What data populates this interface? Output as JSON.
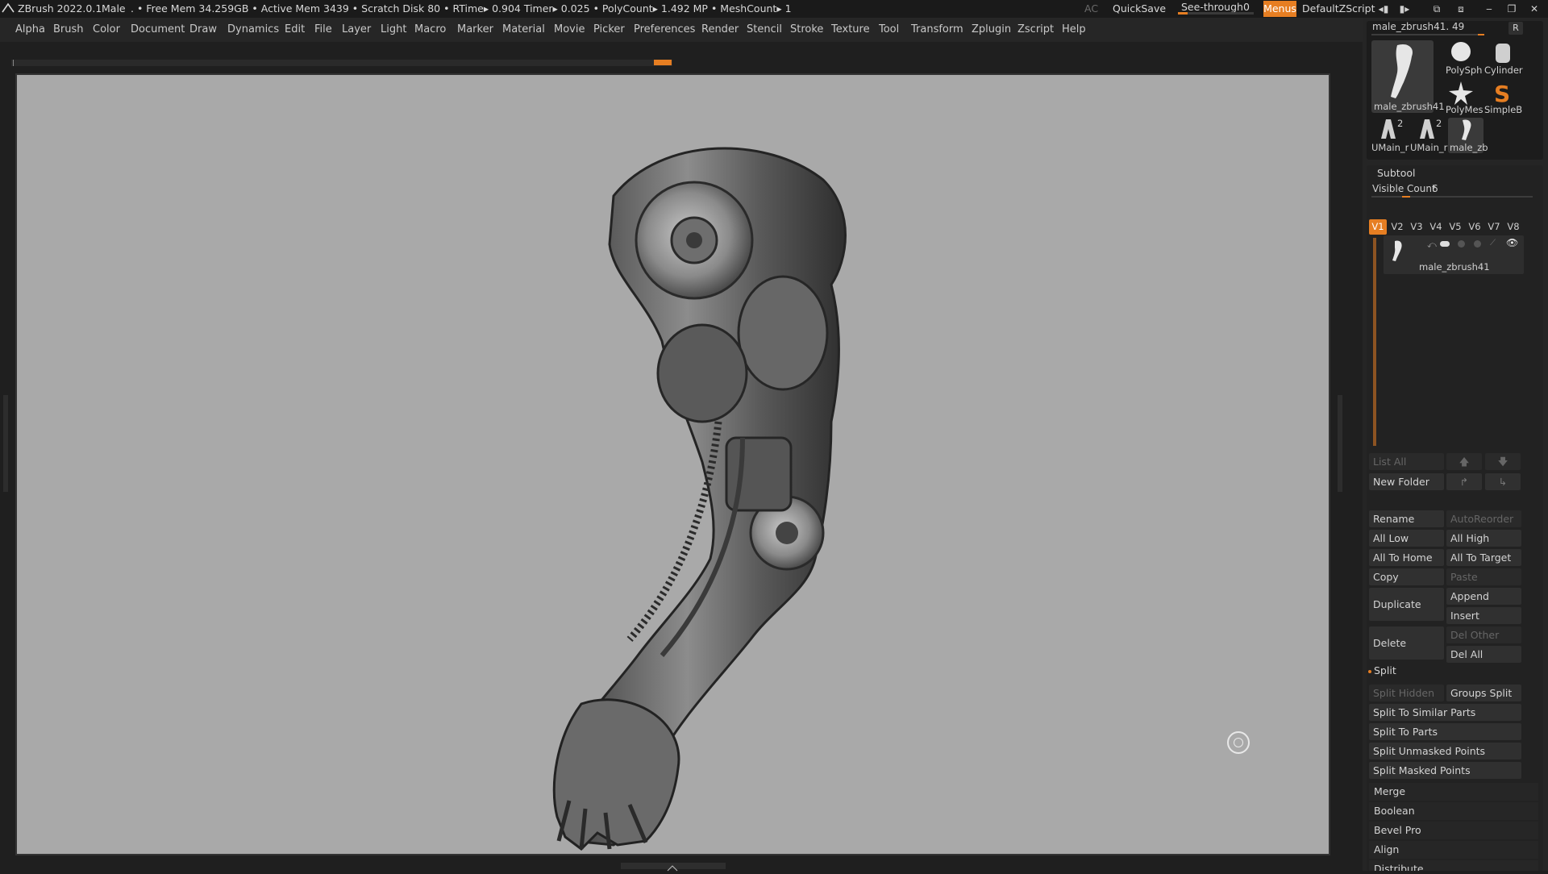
{
  "titlebar": {
    "app_name": "ZBrush 2022.0.1",
    "document": "Male",
    "stats": ". • Free Mem 34.259GB • Active Mem 3439 • Scratch Disk 80 • RTime▸ 0.904 Timer▸ 0.025 • PolyCount▸ 1.492 MP • MeshCount▸ 1",
    "ac": "AC",
    "quicksave": "QuickSave",
    "see_through_label": "See-through",
    "see_through_value": "0",
    "menus": "Menus",
    "script": "DefaultZScript",
    "accent_color": "#e67e22"
  },
  "menubar": {
    "items": [
      "Alpha",
      "Brush",
      "Color",
      "Document",
      "Draw",
      "Dynamics",
      "Edit",
      "File",
      "Layer",
      "Light",
      "Macro",
      "Marker",
      "Material",
      "Movie",
      "Picker",
      "Preferences",
      "Render",
      "Stencil",
      "Stroke",
      "Texture",
      "Tool",
      "Transform",
      "Zplugin",
      "Zscript",
      "Help"
    ]
  },
  "tool_palette": {
    "current_tool": "male_zbrush41. 49",
    "r_button": "R",
    "thumbs": {
      "main": "male_zbrush41",
      "polysphere": "PolySph",
      "cylinder": "Cylinder",
      "polymesh": "PolyMes",
      "simplebrush": "SimpleB",
      "umain1": "UMain_r",
      "umain1_count": "2",
      "umain2": "UMain_r",
      "umain2_count": "2",
      "male_small": "male_zb"
    }
  },
  "subtool": {
    "header": "Subtool",
    "visible_count_label": "Visible Count",
    "visible_count_value": "6",
    "versions": [
      "V1",
      "V2",
      "V3",
      "V4",
      "V5",
      "V6",
      "V7",
      "V8"
    ],
    "active_version": "V1",
    "item_name": "male_zbrush41",
    "list_all": "List All",
    "new_folder": "New Folder",
    "rename": "Rename",
    "auto_reorder": "AutoReorder",
    "all_low": "All Low",
    "all_high": "All High",
    "all_to_home": "All To Home",
    "all_to_target": "All To Target",
    "copy": "Copy",
    "paste": "Paste",
    "duplicate": "Duplicate",
    "append": "Append",
    "insert": "Insert",
    "delete": "Delete",
    "del_other": "Del Other",
    "del_all": "Del All"
  },
  "split": {
    "header": "Split",
    "split_hidden": "Split Hidden",
    "groups_split": "Groups Split",
    "split_to_similar": "Split To Similar Parts",
    "split_to_parts": "Split To Parts",
    "split_unmasked": "Split Unmasked Points",
    "split_masked": "Split Masked Points"
  },
  "sections": {
    "merge": "Merge",
    "boolean": "Boolean",
    "bevel_pro": "Bevel Pro",
    "align": "Align",
    "distribute": "Distribute"
  }
}
